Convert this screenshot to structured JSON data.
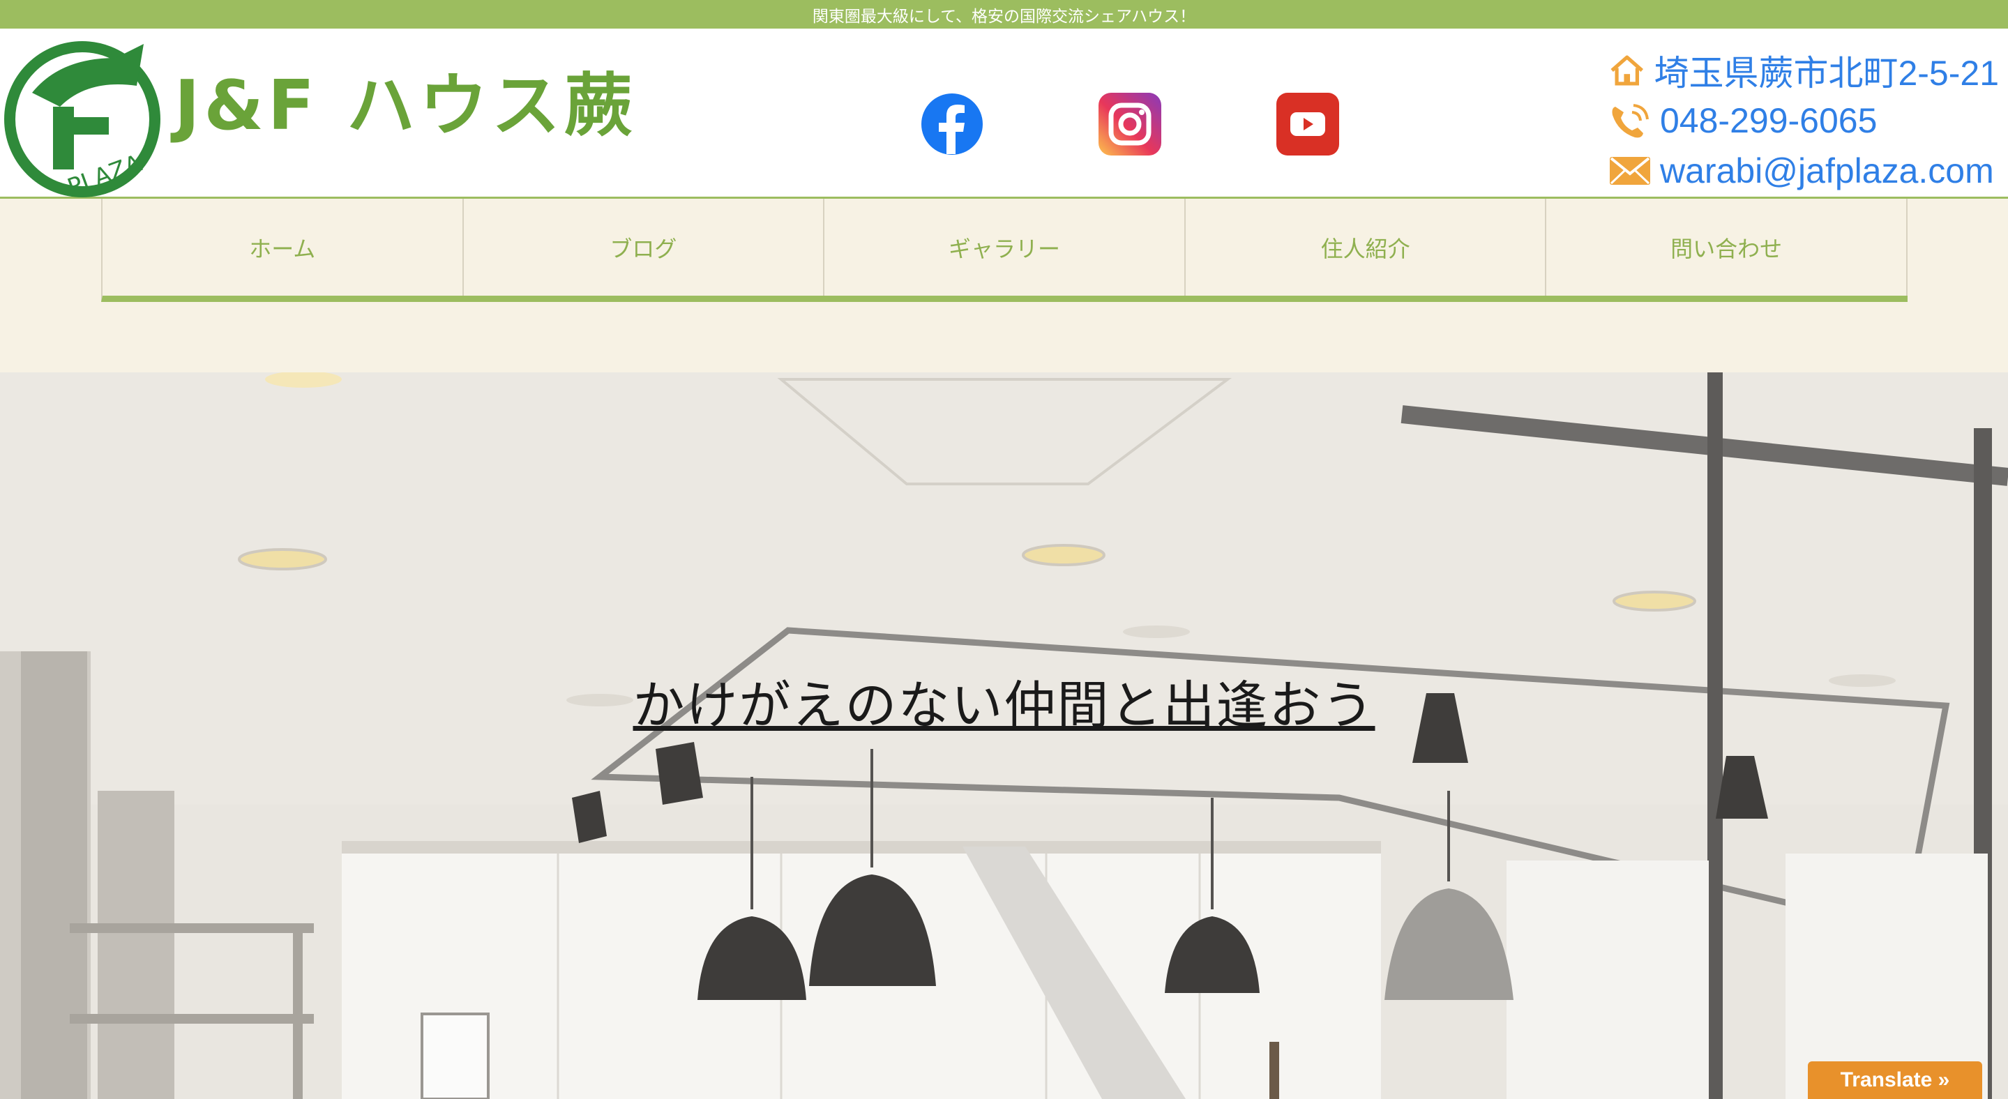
{
  "topbar": {
    "tagline": "関東圏最大級にして、格安の国際交流シェアハウス！"
  },
  "header": {
    "logo_text": "PLAZA",
    "brand": "J&F ハウス蕨",
    "social": [
      {
        "name": "facebook-icon",
        "color": "#1877f2"
      },
      {
        "name": "instagram-icon",
        "color": "#d6249f"
      },
      {
        "name": "youtube-icon",
        "color": "#d93025"
      }
    ],
    "contact": {
      "address": "埼玉県蕨市北町2-5-21",
      "phone": "048-299-6065",
      "email": "warabi@jafplaza.com",
      "icon_color": "#f0a53c"
    }
  },
  "nav": {
    "items": [
      {
        "label": "ホーム"
      },
      {
        "label": "ブログ"
      },
      {
        "label": "ギャラリー"
      },
      {
        "label": "住人紹介"
      },
      {
        "label": "問い合わせ"
      }
    ]
  },
  "hero": {
    "title": "かけがえのない仲間と出逢おう"
  },
  "translate": {
    "label": "Translate »"
  },
  "colors": {
    "accent": "#9cbd5f",
    "brand_green": "#6aa339",
    "nav_bg": "#f7f2e4",
    "link_blue": "#2f7fe6"
  }
}
